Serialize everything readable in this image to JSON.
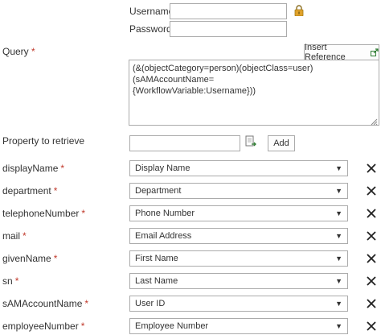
{
  "credentials": {
    "username_label": "Username",
    "password_label": "Password",
    "username_value": "",
    "password_value": ""
  },
  "query": {
    "label": "Query",
    "required_mark": "*",
    "insert_reference_label": "Insert Reference",
    "value": "(&(objectCategory=person)(objectClass=user)(sAMAccountName=\n{WorkflowVariable:Username}))"
  },
  "property_to_retrieve": {
    "label": "Property to retrieve",
    "value": "",
    "add_label": "Add"
  },
  "mappings": [
    {
      "property": "displayName",
      "required_mark": "*",
      "selected": "Display Name"
    },
    {
      "property": "department",
      "required_mark": "*",
      "selected": "Department"
    },
    {
      "property": "telephoneNumber",
      "required_mark": "*",
      "selected": "Phone Number"
    },
    {
      "property": "mail",
      "required_mark": "*",
      "selected": "Email Address"
    },
    {
      "property": "givenName",
      "required_mark": "*",
      "selected": "First Name"
    },
    {
      "property": "sn",
      "required_mark": "*",
      "selected": "Last Name"
    },
    {
      "property": "sAMAccountName",
      "required_mark": "*",
      "selected": "User ID"
    },
    {
      "property": "employeeNumber",
      "required_mark": "*",
      "selected": "Employee Number"
    }
  ],
  "icons": {
    "lock": "lock-icon",
    "insert_reference": "insert-reference-icon",
    "property_picker": "property-picker-icon",
    "remove": "close-icon",
    "dropdown": "chevron-down-icon"
  },
  "colors": {
    "required": "#c0392b",
    "lock": "#e0a22a",
    "border": "#ababab",
    "text": "#333333"
  }
}
